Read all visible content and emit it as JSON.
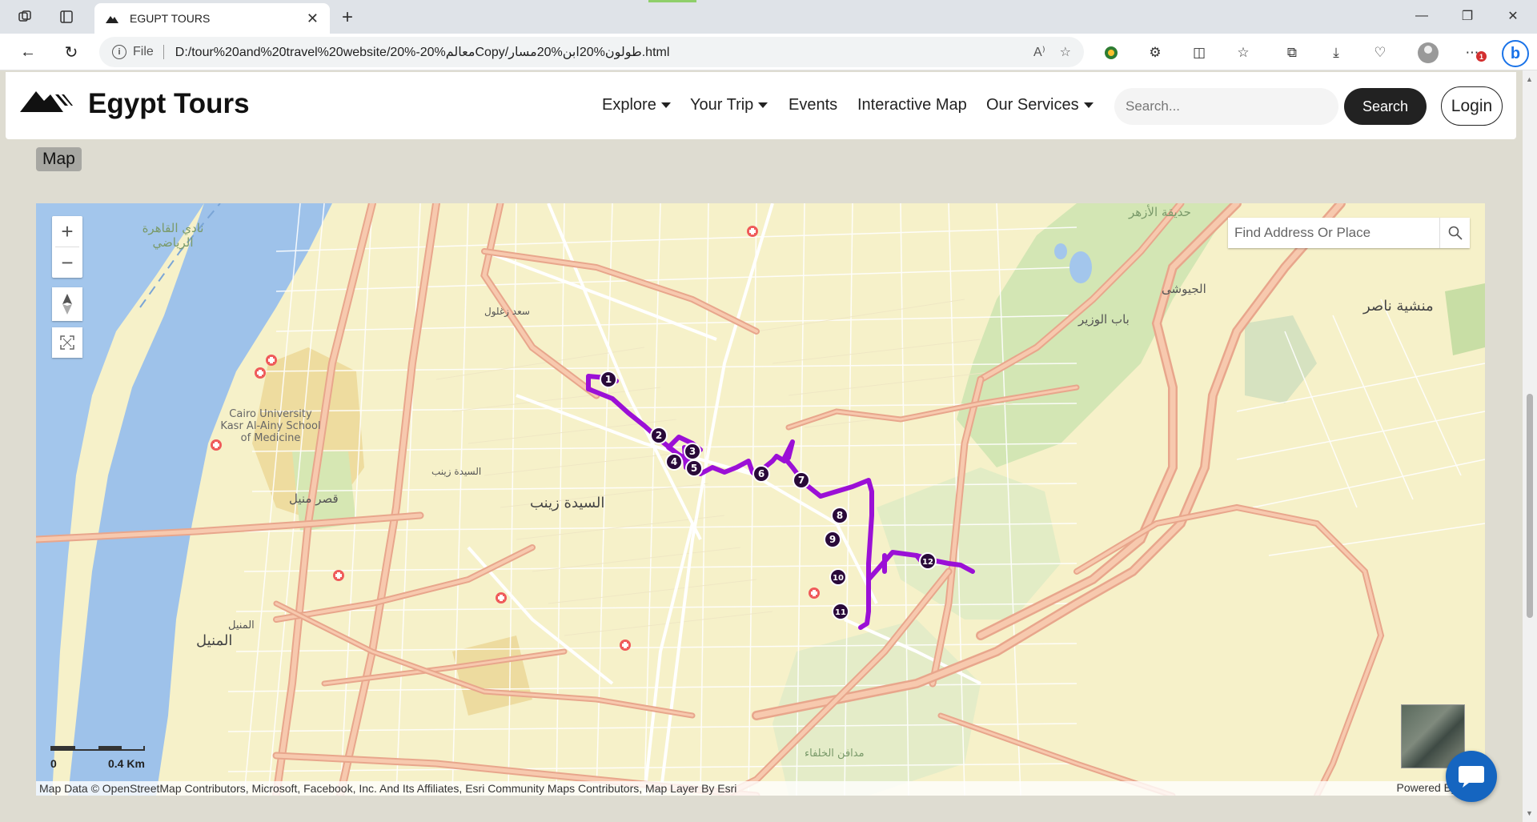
{
  "browser": {
    "tab_title": "EGUPT TOURS",
    "address_prefix": "File",
    "url": "D:/tour%20and%20travel%20website/20%-20%معالمCopy/طولون%20ابن%20مسار.html",
    "notification_count": "1"
  },
  "site": {
    "logo_text": "Egypt Tours",
    "nav": [
      {
        "label": "Explore",
        "has_dropdown": true
      },
      {
        "label": "Your Trip",
        "has_dropdown": true
      },
      {
        "label": "Events",
        "has_dropdown": false
      },
      {
        "label": "Interactive Map",
        "has_dropdown": false
      },
      {
        "label": "Our Services",
        "has_dropdown": true
      }
    ],
    "search_placeholder": "Search...",
    "search_button": "Search",
    "login_button": "Login"
  },
  "section_label": "Map",
  "map": {
    "search_placeholder": "Find Address Or Place",
    "scale_start": "0",
    "scale_end": "0.4 Km",
    "attribution": "Map Data © OpenStreetMap Contributors, Microsoft, Facebook, Inc. And Its Affiliates, Esri Community Maps Contributors, Map Layer By Esri",
    "powered_by": "Powered By",
    "route_color": "#9b10d6",
    "route_stops": [
      "1",
      "2",
      "3",
      "4",
      "5",
      "6",
      "7",
      "8",
      "9",
      "10",
      "11",
      "12"
    ],
    "place_labels": {
      "sayeda_zeinab": "السيدة زينب",
      "manshiyet_naser": "منشية ناصر",
      "manial": "المنيل",
      "qasr_manial": "قصر منيل",
      "bab_alwazir": "باب الوزير",
      "gabaly": "الجيوشى",
      "cairo_university": "Cairo University Kasr Al-Ainy School of Medicine",
      "nadi_qahira": "نادي القاهرة الرياضي",
      "hadiqat_azhar": "حديقة الأزهر",
      "saad_zaghloul": "سعد زغلول",
      "madafen": "مدافن الخلفاء",
      "sayeda_station": "السيدة زينب",
      "manial_small": "المنيل"
    }
  }
}
